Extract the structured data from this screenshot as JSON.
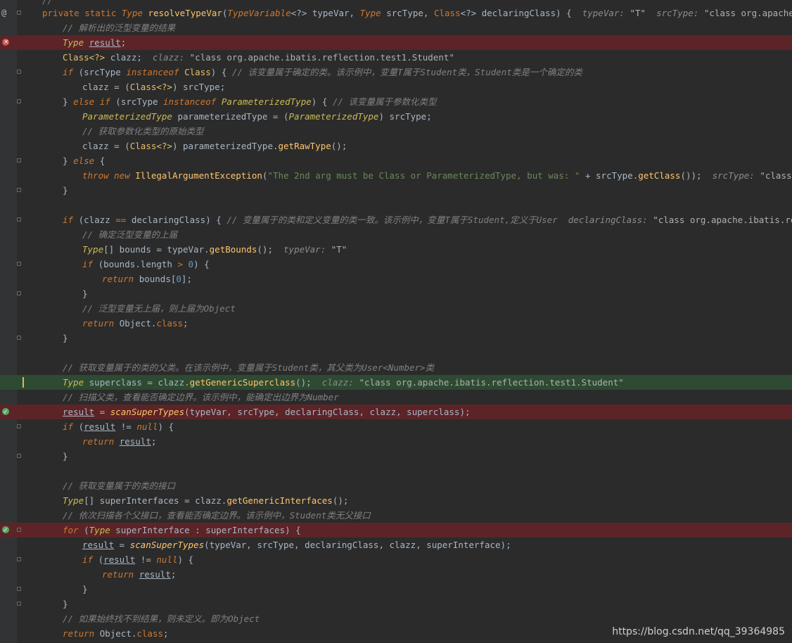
{
  "editor": {
    "lines": [
      {
        "id": "l0",
        "text": "//"
      },
      {
        "id": "l1",
        "segs": [
          [
            "kw",
            "private static "
          ],
          [
            "typ",
            "Type "
          ],
          [
            "fn",
            "resolveTypeVar"
          ],
          [
            "par",
            "("
          ],
          [
            "typ",
            "TypeVariable"
          ],
          [
            "var",
            "<?> "
          ],
          [
            "var",
            "typeVar"
          ],
          [
            "par",
            ", "
          ],
          [
            "typ",
            "Type "
          ],
          [
            "var",
            "srcType"
          ],
          [
            "par",
            ", "
          ],
          [
            "kw",
            "Class"
          ],
          [
            "var",
            "<?> "
          ],
          [
            "var",
            "declaringClass"
          ],
          [
            "par",
            ") {  "
          ],
          [
            "hint",
            "typeVar: "
          ],
          [
            "hintv",
            "\"T\""
          ],
          [
            "hint",
            "  srcType: "
          ],
          [
            "hintv",
            "\"class org.apache.ibatis.re"
          ]
        ]
      },
      {
        "id": "l2",
        "segs": [
          [
            "cm",
            "// 解析出的泛型变量的结果"
          ]
        ]
      },
      {
        "id": "l3",
        "segs": [
          [
            "tcls",
            "Type "
          ],
          [
            "ul",
            "result"
          ],
          [
            "var",
            ";"
          ]
        ]
      },
      {
        "id": "l4",
        "segs": [
          [
            "sw",
            "Class<?> "
          ],
          [
            "var",
            "clazz;  "
          ],
          [
            "hint",
            "clazz: "
          ],
          [
            "hintv",
            "\"class org.apache.ibatis.reflection.test1.Student\""
          ]
        ]
      },
      {
        "id": "l5",
        "segs": [
          [
            "kwi",
            "if "
          ],
          [
            "par",
            "("
          ],
          [
            "var",
            "srcType "
          ],
          [
            "kwi",
            "instanceof "
          ],
          [
            "sw",
            "Class"
          ],
          [
            "par",
            ") { "
          ],
          [
            "cm",
            "// 该变量属于确定的类。该示例中，变量T属于Student类，Student类是一个确定的类"
          ]
        ]
      },
      {
        "id": "l6",
        "segs": [
          [
            "var",
            "clazz = "
          ],
          [
            "par",
            "("
          ],
          [
            "sw",
            "Class<?>"
          ],
          [
            "par",
            ") "
          ],
          [
            "var",
            "srcType;"
          ]
        ]
      },
      {
        "id": "l7",
        "segs": [
          [
            "par",
            "} "
          ],
          [
            "kwi",
            "else if "
          ],
          [
            "par",
            "("
          ],
          [
            "var",
            "srcType "
          ],
          [
            "kwi",
            "instanceof "
          ],
          [
            "tcls",
            "ParameterizedType"
          ],
          [
            "par",
            ") { "
          ],
          [
            "cm",
            "// 该变量属于参数化类型"
          ]
        ]
      },
      {
        "id": "l8",
        "segs": [
          [
            "tcls",
            "ParameterizedType "
          ],
          [
            "var",
            "parameterizedType = "
          ],
          [
            "par",
            "("
          ],
          [
            "tcls",
            "ParameterizedType"
          ],
          [
            "par",
            ") "
          ],
          [
            "var",
            "srcType;"
          ]
        ]
      },
      {
        "id": "l9",
        "segs": [
          [
            "cm",
            "// 获取参数化类型的原始类型"
          ]
        ]
      },
      {
        "id": "l10",
        "segs": [
          [
            "var",
            "clazz = "
          ],
          [
            "par",
            "("
          ],
          [
            "sw",
            "Class<?>"
          ],
          [
            "par",
            ") "
          ],
          [
            "var",
            "parameterizedType."
          ],
          [
            "mc",
            "getRawType"
          ],
          [
            "par",
            "()"
          ],
          [
            "var",
            ";"
          ]
        ]
      },
      {
        "id": "l11",
        "segs": [
          [
            "par",
            "} "
          ],
          [
            "kwi",
            "else "
          ],
          [
            "par",
            "{"
          ]
        ]
      },
      {
        "id": "l12",
        "segs": [
          [
            "kwi",
            "throw new "
          ],
          [
            "fn",
            "IllegalArgumentException"
          ],
          [
            "par",
            "("
          ],
          [
            "st",
            "\"The 2nd arg must be Class or ParameterizedType, but was: \" "
          ],
          [
            "var",
            "+ srcType."
          ],
          [
            "mc",
            "getClass"
          ],
          [
            "par",
            "()"
          ],
          [
            "var",
            ");  "
          ],
          [
            "hint",
            "srcType: "
          ],
          [
            "hintv",
            "\"class org.apache"
          ]
        ]
      },
      {
        "id": "l13",
        "segs": [
          [
            "par",
            "}"
          ]
        ]
      },
      {
        "id": "l14",
        "segs": []
      },
      {
        "id": "l15",
        "segs": [
          [
            "kwi",
            "if "
          ],
          [
            "par",
            "("
          ],
          [
            "var",
            "clazz "
          ],
          [
            "kw",
            "== "
          ],
          [
            "var",
            "declaringClass"
          ],
          [
            "par",
            ") { "
          ],
          [
            "cm",
            "// 变量属于的类和定义变量的类一致。该示例中，变量T属于Student,定义于User  "
          ],
          [
            "hint",
            "declaringClass: "
          ],
          [
            "hintv",
            "\"class org.apache.ibatis.reflection"
          ]
        ]
      },
      {
        "id": "l16",
        "segs": [
          [
            "cm",
            "// 确定泛型变量的上届"
          ]
        ]
      },
      {
        "id": "l17",
        "segs": [
          [
            "tcls",
            "Type"
          ],
          [
            "var",
            "[] bounds = "
          ],
          [
            "var",
            "typeVar."
          ],
          [
            "mc",
            "getBounds"
          ],
          [
            "par",
            "()"
          ],
          [
            "var",
            ";  "
          ],
          [
            "hint",
            "typeVar: "
          ],
          [
            "hintv",
            "\"T\""
          ]
        ]
      },
      {
        "id": "l18",
        "segs": [
          [
            "kwi",
            "if "
          ],
          [
            "par",
            "("
          ],
          [
            "var",
            "bounds.length "
          ],
          [
            "kw",
            "> "
          ],
          [
            "num",
            "0"
          ],
          [
            "par",
            ") {"
          ]
        ]
      },
      {
        "id": "l19",
        "segs": [
          [
            "kwi",
            "return "
          ],
          [
            "var",
            "bounds"
          ],
          [
            "par",
            "["
          ],
          [
            "num",
            "0"
          ],
          [
            "par",
            "]"
          ],
          [
            "var",
            ";"
          ]
        ]
      },
      {
        "id": "l20",
        "segs": [
          [
            "par",
            "}"
          ]
        ]
      },
      {
        "id": "l21",
        "segs": [
          [
            "cm",
            "// 泛型变量无上届，则上届为Object"
          ]
        ]
      },
      {
        "id": "l22",
        "segs": [
          [
            "kwi",
            "return "
          ],
          [
            "var",
            "Object."
          ],
          [
            "kw",
            "class"
          ],
          [
            "var",
            ";"
          ]
        ]
      },
      {
        "id": "l23",
        "segs": [
          [
            "par",
            "}"
          ]
        ]
      },
      {
        "id": "l24",
        "segs": []
      },
      {
        "id": "l25",
        "segs": [
          [
            "cm",
            "// 获取变量属于的类的父类。在该示例中，变量属于Student类，其父类为User<Number>类"
          ]
        ]
      },
      {
        "id": "l26",
        "segs": [
          [
            "tcls",
            "Type "
          ],
          [
            "var",
            "superclass = clazz."
          ],
          [
            "mc",
            "getGenericSuperclass"
          ],
          [
            "par",
            "()"
          ],
          [
            "var",
            ";  "
          ],
          [
            "hint",
            "clazz: "
          ],
          [
            "hintv",
            "\"class org.apache.ibatis.reflection.test1.Student\""
          ]
        ]
      },
      {
        "id": "l27",
        "segs": [
          [
            "cm",
            "// 扫描父类，查看能否确定边界。该示例中，能确定出边界为Number"
          ]
        ]
      },
      {
        "id": "l28",
        "segs": [
          [
            "ul",
            "result"
          ],
          [
            "var",
            " = "
          ],
          [
            "sm",
            "scanSuperTypes"
          ],
          [
            "par",
            "("
          ],
          [
            "var",
            "typeVar, srcType, declaringClass, clazz, superclass"
          ],
          [
            "par",
            ")"
          ],
          [
            "var",
            ";"
          ]
        ]
      },
      {
        "id": "l29",
        "segs": [
          [
            "kwi",
            "if "
          ],
          [
            "par",
            "("
          ],
          [
            "ul",
            "result"
          ],
          [
            "var",
            " != "
          ],
          [
            "kwi",
            "null"
          ],
          [
            "par",
            ") {"
          ]
        ]
      },
      {
        "id": "l30",
        "segs": [
          [
            "kwi",
            "return "
          ],
          [
            "ul",
            "result"
          ],
          [
            "var",
            ";"
          ]
        ]
      },
      {
        "id": "l31",
        "segs": [
          [
            "par",
            "}"
          ]
        ]
      },
      {
        "id": "l32",
        "segs": []
      },
      {
        "id": "l33",
        "segs": [
          [
            "cm",
            "// 获取变量属于的类的接口"
          ]
        ]
      },
      {
        "id": "l34",
        "segs": [
          [
            "tcls",
            "Type"
          ],
          [
            "var",
            "[] superInterfaces = clazz."
          ],
          [
            "mc",
            "getGenericInterfaces"
          ],
          [
            "par",
            "()"
          ],
          [
            "var",
            ";"
          ]
        ]
      },
      {
        "id": "l35",
        "segs": [
          [
            "cm",
            "// 依次扫描各个父接口，查看能否确定边界。该示例中，Student类无父接口"
          ]
        ]
      },
      {
        "id": "l36",
        "segs": [
          [
            "kwi",
            "for "
          ],
          [
            "par",
            "("
          ],
          [
            "tcls",
            "Type "
          ],
          [
            "var",
            "superInterface : superInterfaces"
          ],
          [
            "par",
            ") {"
          ]
        ]
      },
      {
        "id": "l37",
        "segs": [
          [
            "ul",
            "result"
          ],
          [
            "var",
            " = "
          ],
          [
            "sm",
            "scanSuperTypes"
          ],
          [
            "par",
            "("
          ],
          [
            "var",
            "typeVar, srcType, declaringClass, clazz, superInterface"
          ],
          [
            "par",
            ")"
          ],
          [
            "var",
            ";"
          ]
        ]
      },
      {
        "id": "l38",
        "segs": [
          [
            "kwi",
            "if "
          ],
          [
            "par",
            "("
          ],
          [
            "ul",
            "result"
          ],
          [
            "var",
            " != "
          ],
          [
            "kwi",
            "null"
          ],
          [
            "par",
            ") {"
          ]
        ]
      },
      {
        "id": "l39",
        "segs": [
          [
            "kwi",
            "return "
          ],
          [
            "ul",
            "result"
          ],
          [
            "var",
            ";"
          ]
        ]
      },
      {
        "id": "l40",
        "segs": [
          [
            "par",
            "}"
          ]
        ]
      },
      {
        "id": "l41",
        "segs": [
          [
            "par",
            "}"
          ]
        ]
      },
      {
        "id": "l42",
        "segs": [
          [
            "cm",
            "// 如果始终找不到结果，则未定义。即为Object"
          ]
        ]
      },
      {
        "id": "l43",
        "segs": [
          [
            "kwi",
            "return "
          ],
          [
            "var",
            "Object."
          ],
          [
            "kw",
            "class"
          ],
          [
            "var",
            ";"
          ]
        ]
      }
    ]
  },
  "watermark": "https://blog.csdn.net/qq_39364985"
}
